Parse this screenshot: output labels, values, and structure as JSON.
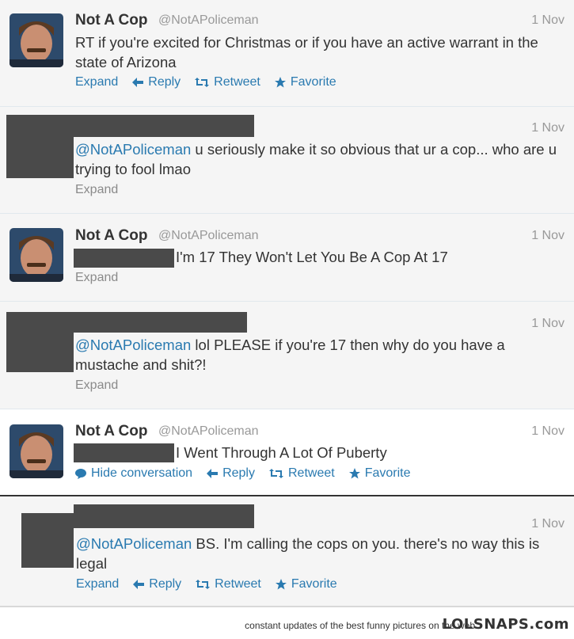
{
  "user": {
    "name": "Not A Cop",
    "handle": "@NotAPoliceman"
  },
  "tweets": [
    {
      "date": "1 Nov",
      "text": "RT if you're excited for Christmas or if you have an active warrant in the state of Arizona",
      "actions": {
        "expand": "Expand",
        "reply": "Reply",
        "retweet": "Retweet",
        "favorite": "Favorite"
      }
    },
    {
      "date": "1 Nov",
      "mention": "@NotAPoliceman",
      "text": " u seriously make it so obvious that ur a cop... who are u trying to fool lmao",
      "expand": "Expand"
    },
    {
      "date": "1 Nov",
      "text": "I'm 17 They Won't Let You Be A Cop At 17",
      "expand": "Expand"
    },
    {
      "date": "1 Nov",
      "mention": "@NotAPoliceman",
      "text": " lol PLEASE if you're 17 then why do you have a mustache and shit?!",
      "expand": "Expand"
    },
    {
      "date": "1 Nov",
      "text": "I Went Through A Lot Of Puberty",
      "actions": {
        "hide": "Hide conversation",
        "reply": "Reply",
        "retweet": "Retweet",
        "favorite": "Favorite"
      }
    },
    {
      "date": "1 Nov",
      "mention": "@NotAPoliceman",
      "text": " BS. I'm calling the cops on you. there's no way this is legal",
      "actions": {
        "expand": "Expand",
        "reply": "Reply",
        "retweet": "Retweet",
        "favorite": "Favorite"
      }
    }
  ],
  "footer": {
    "tagline": "constant updates of the best funny pictures on the web",
    "logo": "LOLSNAPS.com"
  },
  "colors": {
    "link": "#2a7ab0",
    "redaction": "#4a4a4a",
    "muted": "#999999"
  }
}
